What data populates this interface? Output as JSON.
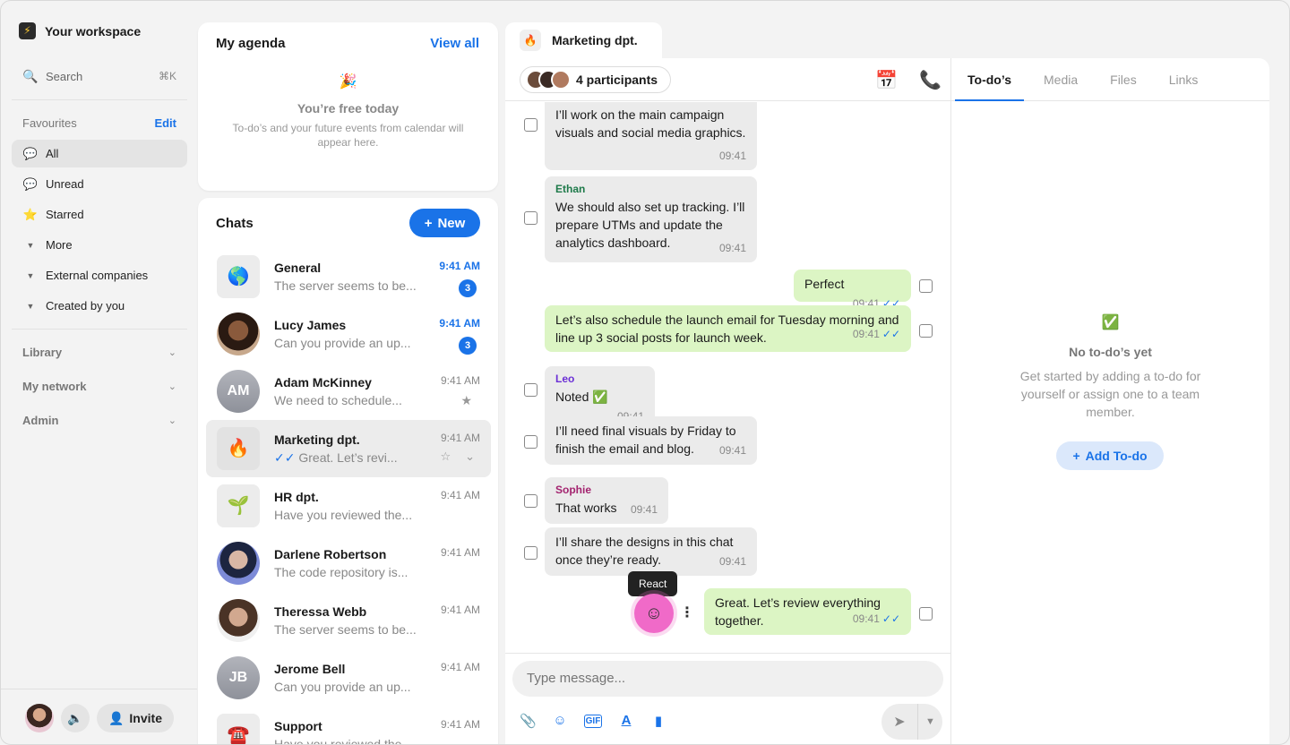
{
  "workspace": {
    "name": "Your workspace"
  },
  "search": {
    "placeholder": "Search",
    "shortcut": "⌘K"
  },
  "favourites": {
    "title": "Favourites",
    "edit_label": "Edit",
    "items": [
      {
        "label": "All",
        "icon": "chat-bubble-icon"
      },
      {
        "label": "Unread",
        "icon": "unread-bubble-icon"
      },
      {
        "label": "Starred",
        "icon": "star-icon"
      },
      {
        "label": "More",
        "icon": "caret-down-icon"
      },
      {
        "label": "External companies",
        "icon": "caret-down-icon"
      },
      {
        "label": "Created by you",
        "icon": "caret-down-icon"
      }
    ]
  },
  "sections": [
    {
      "label": "Library"
    },
    {
      "label": "My network"
    },
    {
      "label": "Admin"
    }
  ],
  "bottom": {
    "invite_label": "Invite"
  },
  "agenda": {
    "title": "My agenda",
    "view_all": "View all",
    "free_title": "You’re free today",
    "free_sub": "To-do’s and your future events from calendar will appear here."
  },
  "chats": {
    "title": "Chats",
    "new_label": "New",
    "list": [
      {
        "name": "General",
        "preview": "The server seems to be...",
        "time": "9:41 AM",
        "unread": "3",
        "avatar": "🌎"
      },
      {
        "name": "Lucy James",
        "preview": "Can you provide an up...",
        "time": "9:41 AM",
        "unread": "3"
      },
      {
        "name": "Adam McKinney",
        "preview": "We need to schedule...",
        "time": "9:41 AM",
        "initials": "AM"
      },
      {
        "name": "Marketing dpt.",
        "preview": "Great. Let’s revi...",
        "time": "9:41 AM",
        "avatar": "🔥"
      },
      {
        "name": "HR dpt.",
        "preview": "Have you reviewed the...",
        "time": "9:41 AM",
        "avatar": "🌱"
      },
      {
        "name": "Darlene Robertson",
        "preview": "The code repository is...",
        "time": "9:41 AM"
      },
      {
        "name": "Theressa Webb",
        "preview": "The server seems to be...",
        "time": "9:41 AM"
      },
      {
        "name": "Jerome Bell",
        "preview": "Can you provide an up...",
        "time": "9:41 AM",
        "initials": "JB"
      },
      {
        "name": "Support",
        "preview": "Have you reviewed the...",
        "time": "9:41 AM",
        "avatar": "☎️"
      }
    ]
  },
  "conversation": {
    "tab_title": "Marketing dpt.",
    "tab_icon": "🔥",
    "participants_label": "4 participants",
    "messages": [
      {
        "text": "I’ll work on the main campaign visuals and social media graphics.",
        "time": "09:41"
      },
      {
        "sender": "Ethan",
        "text": "We should also set up tracking. I’ll prepare UTMs and update the analytics dashboard.",
        "time": "09:41"
      },
      {
        "text": "Perfect",
        "time": "09:41"
      },
      {
        "text": "Let’s also schedule the launch email for Tuesday morning and line up 3 social posts for launch week.",
        "time": "09:41"
      },
      {
        "sender": "Leo",
        "text": "Noted ✅",
        "time": "09:41"
      },
      {
        "text": "I’ll need final visuals by Friday to finish the email and blog.",
        "time": "09:41"
      },
      {
        "sender": "Sophie",
        "text": "That works",
        "time": "09:41"
      },
      {
        "text": "I’ll share the designs in this chat once they’re ready.",
        "time": "09:41"
      },
      {
        "text": "Great. Let’s review everything together.",
        "time": "09:41"
      }
    ],
    "tooltip": "React",
    "composer_placeholder": "Type message..."
  },
  "right_panel": {
    "tabs": [
      "To-do’s",
      "Media",
      "Files",
      "Links"
    ],
    "empty_icon": "✅",
    "empty_title": "No to-do’s yet",
    "empty_sub": "Get started by adding a to-do for yourself or assign one to a team member.",
    "add_label": "Add To-do"
  },
  "colors": {
    "accent": "#1a73e8",
    "out_bubble": "#dcf5c4",
    "in_bubble": "#ebebeb",
    "react": "#f06ac8",
    "ethan": "#1e7a4a",
    "leo": "#6b2fd6",
    "sophie": "#a3236f"
  }
}
